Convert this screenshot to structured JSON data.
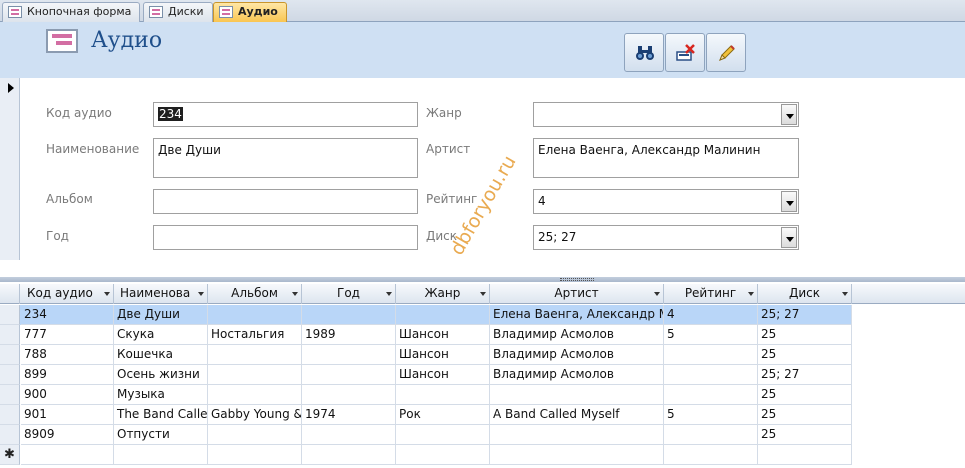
{
  "tabs": [
    {
      "label": "Кнопочная форма",
      "active": false
    },
    {
      "label": "Диски",
      "active": false
    },
    {
      "label": "Аудио",
      "active": true
    }
  ],
  "header": {
    "title": "Аудио"
  },
  "toolbar": {
    "icons": [
      "binoculars-icon",
      "delete-record-icon",
      "pencil-icon"
    ]
  },
  "form": {
    "labels": {
      "code": "Код аудио",
      "name": "Наименование",
      "album": "Альбом",
      "year": "Год",
      "genre": "Жанр",
      "artist": "Артист",
      "rating": "Рейтинг",
      "disk": "Диск"
    },
    "values": {
      "code": "234",
      "name": "Две Души",
      "album": "",
      "year": "",
      "genre": "",
      "artist": "Елена Ваенга, Александр Малинин",
      "rating": "4",
      "disk": "25; 27"
    }
  },
  "watermark": "dbforyou.ru",
  "table": {
    "columns": [
      "Код аудио",
      "Наименова",
      "Альбом",
      "Год",
      "Жанр",
      "Артист",
      "Рейтинг",
      "Диск"
    ],
    "rows": [
      [
        "234",
        "Две Души",
        "",
        "",
        "",
        "Елена Ваенга, Александр М",
        "4",
        "25; 27"
      ],
      [
        "777",
        "Скука",
        "Ностальгия",
        "1989",
        "Шансон",
        "Владимир Асмолов",
        "5",
        "25"
      ],
      [
        "788",
        "Кошечка",
        "",
        "",
        "Шансон",
        "Владимир Асмолов",
        "",
        "25"
      ],
      [
        "899",
        "Осень жизни",
        "",
        "",
        "Шансон",
        "Владимир Асмолов",
        "",
        "25; 27"
      ],
      [
        "900",
        "Музыка",
        "",
        "",
        "",
        "",
        "",
        "25"
      ],
      [
        "901",
        "The Band Calle",
        "Gabby Young &",
        "1974",
        "Рок",
        "A Band Called Myself",
        "5",
        "25"
      ],
      [
        "8909",
        "Отпусти",
        "",
        "",
        "",
        "",
        "",
        "25"
      ]
    ],
    "new_row_marker": "✱"
  },
  "colors": {
    "header_bg": "#cfe0f3",
    "title": "#1f4f8b",
    "active_tab": "#f9c44d",
    "current_row": "#b9d6f8",
    "watermark": "#e7a13e"
  }
}
